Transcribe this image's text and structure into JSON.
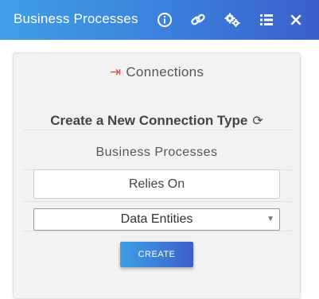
{
  "header": {
    "title": "Business Processes",
    "icons": [
      "info-icon",
      "link-icon",
      "gears-icon",
      "list-icon",
      "close-icon"
    ]
  },
  "panel": {
    "connections_label": "Connections",
    "create_title": "Create a New Connection Type",
    "source_label": "Business Processes",
    "relation_value": "Relies On",
    "target_selected": "Data Entities",
    "create_button_label": "CREATE"
  },
  "colors": {
    "header_start": "#3f9fe6",
    "header_end": "#3a5fc9",
    "connections_icon": "#d9534f",
    "panel_bg": "#f2f2f2"
  }
}
